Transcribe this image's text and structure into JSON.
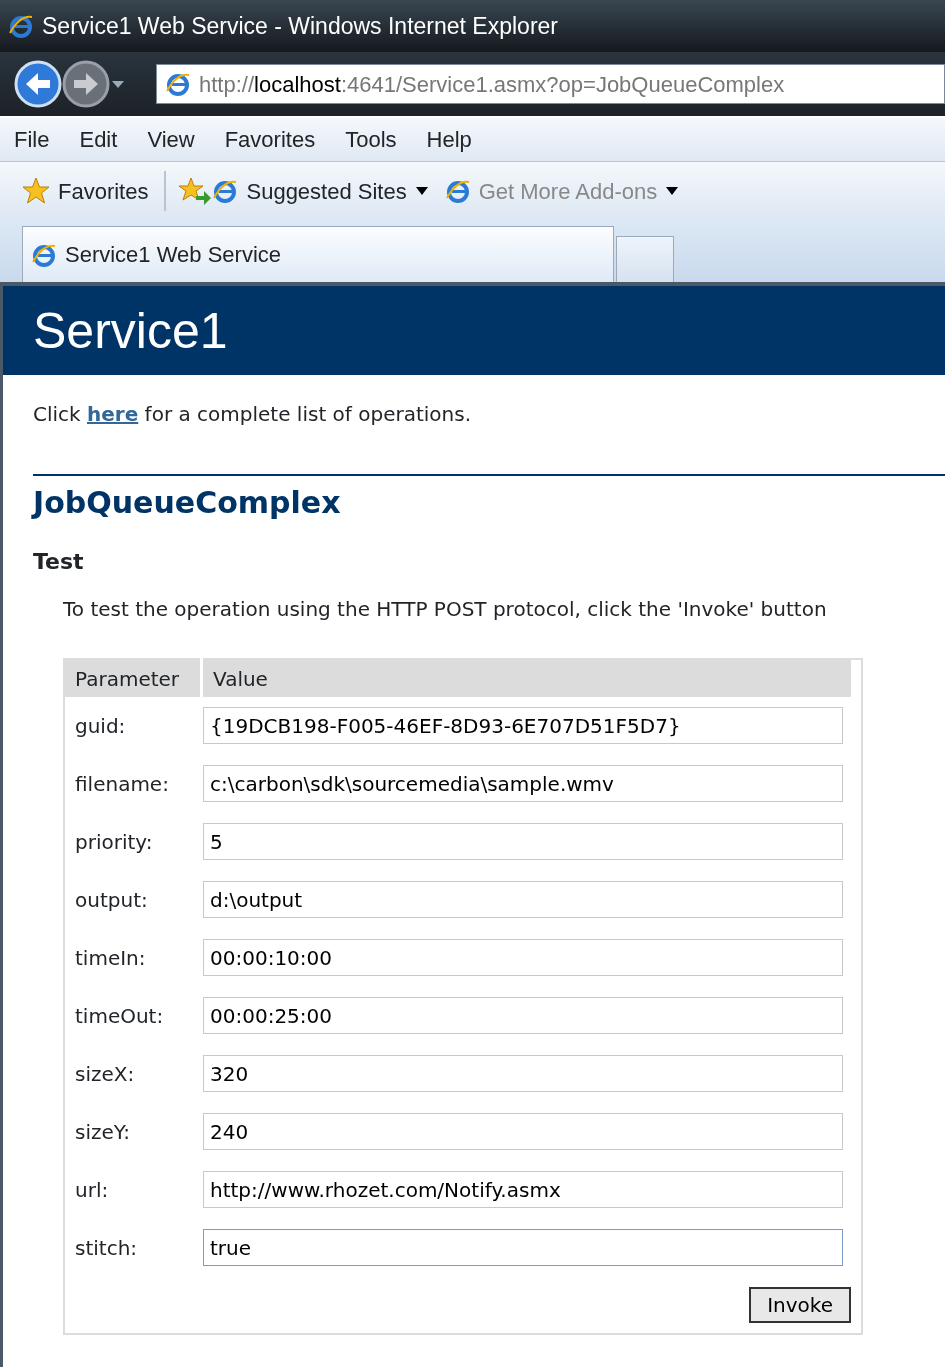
{
  "window": {
    "title": "Service1 Web Service - Windows Internet Explorer"
  },
  "address": {
    "url_host_prefix": "http://",
    "url_host": "localhost",
    "url_rest": ":4641/Service1.asmx?op=JobQueueComplex"
  },
  "menu": [
    "File",
    "Edit",
    "View",
    "Favorites",
    "Tools",
    "Help"
  ],
  "favorites_bar": [
    {
      "kind": "favorites",
      "label": "Favorites",
      "disabled": false
    },
    {
      "kind": "link",
      "label": "Suggested Sites",
      "disabled": false
    },
    {
      "kind": "link",
      "label": "Get More Add-ons",
      "disabled": true
    }
  ],
  "tabs": [
    {
      "label": "Service1 Web Service",
      "selected": true
    }
  ],
  "page": {
    "title": "Service1",
    "intro_before": "Click",
    "intro_link": "here",
    "intro_after": "for a complete list of operations.",
    "operation": "JobQueueComplex",
    "section": "Test",
    "description": "To test the operation using the HTTP POST protocol, click the 'Invoke' button"
  },
  "table": {
    "columns": [
      "Parameter",
      "Value"
    ],
    "rows": [
      {
        "name": "guid:",
        "value": "{19DCB198-F005-46EF-8D93-6E707D51F5D7}",
        "focused": false
      },
      {
        "name": "filename:",
        "value": "c:\\carbon\\sdk\\sourcemedia\\sample.wmv",
        "focused": false
      },
      {
        "name": "priority:",
        "value": "5",
        "focused": false
      },
      {
        "name": "output:",
        "value": "d:\\output",
        "focused": false
      },
      {
        "name": "timeIn:",
        "value": "00:00:10:00",
        "focused": false
      },
      {
        "name": "timeOut:",
        "value": "00:00:25:00",
        "focused": false
      },
      {
        "name": "sizeX:",
        "value": "320",
        "focused": false
      },
      {
        "name": "sizeY:",
        "value": "240",
        "focused": false
      },
      {
        "name": "url:",
        "value": "http://www.rhozet.com/Notify.asmx",
        "focused": false
      },
      {
        "name": "stitch:",
        "value": "true",
        "focused": true
      }
    ],
    "button": "Invoke"
  }
}
